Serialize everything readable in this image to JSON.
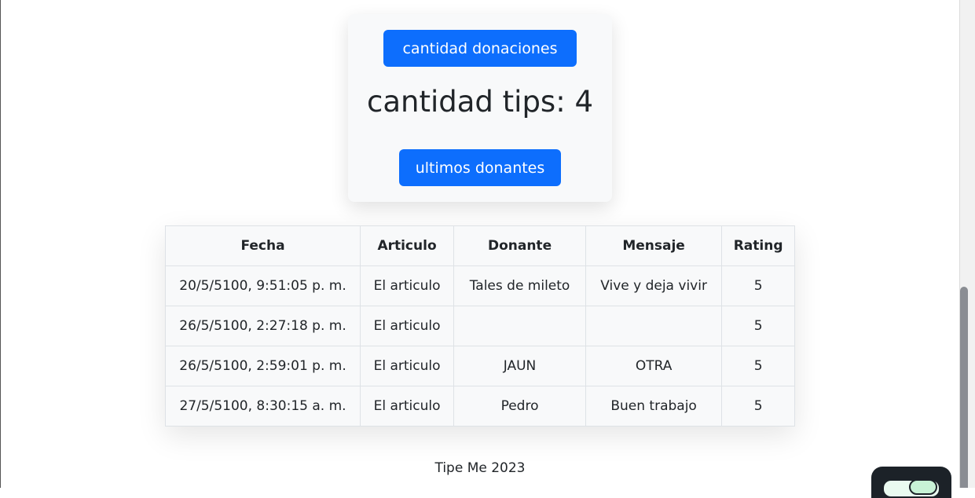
{
  "stats": {
    "donations_button_label": "cantidad donaciones",
    "tips_title": "cantidad tips: 4",
    "donors_button_label": "ultimos donantes"
  },
  "table": {
    "headers": [
      "Fecha",
      "Articulo",
      "Donante",
      "Mensaje",
      "Rating"
    ],
    "rows": [
      [
        "20/5/5100, 9:51:05 p. m.",
        "El articulo",
        "Tales de mileto",
        "Vive y deja vivir",
        "5"
      ],
      [
        "26/5/5100, 2:27:18 p. m.",
        "El articulo",
        "",
        "",
        "5"
      ],
      [
        "26/5/5100, 2:59:01 p. m.",
        "El articulo",
        "JAUN",
        "OTRA",
        "5"
      ],
      [
        "27/5/5100, 8:30:15 a. m.",
        "El articulo",
        "Pedro",
        "Buen trabajo",
        "5"
      ]
    ]
  },
  "footer": {
    "text": "Tipe Me 2023"
  },
  "colors": {
    "primary": "#0d6efd",
    "card_bg": "#f8f9fa",
    "chat_widget_bg": "#1c2228"
  },
  "icons": {
    "chat": "chat-icon"
  }
}
